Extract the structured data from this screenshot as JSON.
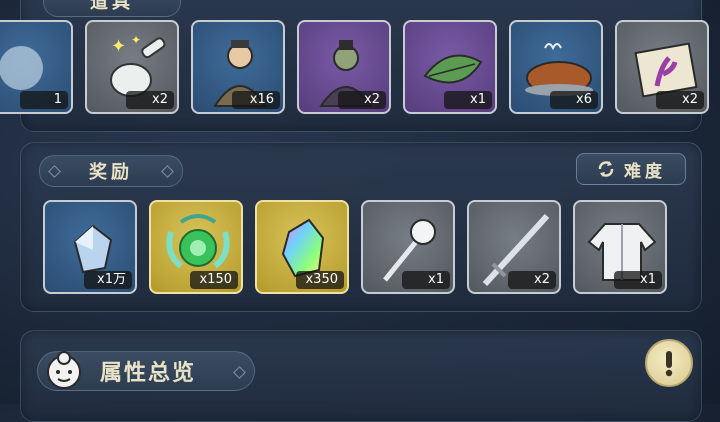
{
  "items_section": {
    "title": "道具",
    "items": [
      {
        "icon": "cut-item-icon",
        "qty": "1",
        "bg": "blue"
      },
      {
        "icon": "sparkling-spoon-icon",
        "qty": "x2",
        "bg": "grey"
      },
      {
        "icon": "villager-figure-icon",
        "qty": "x16",
        "bg": "blue"
      },
      {
        "icon": "dark-figure-icon",
        "qty": "x2",
        "bg": "purple"
      },
      {
        "icon": "green-leaf-icon",
        "qty": "x1",
        "bg": "purple"
      },
      {
        "icon": "roast-pig-icon",
        "qty": "x6",
        "bg": "blue"
      },
      {
        "icon": "scroll-coral-icon",
        "qty": "x2",
        "bg": "grey"
      }
    ]
  },
  "rewards_section": {
    "title": "奖励",
    "difficulty_label": "难度",
    "items": [
      {
        "icon": "blue-crystal-icon",
        "qty": "x1万",
        "bg": "blue"
      },
      {
        "icon": "green-orb-icon",
        "qty": "x150",
        "bg": "gold"
      },
      {
        "icon": "rainbow-crystal-icon",
        "qty": "x350",
        "bg": "gold"
      },
      {
        "icon": "mace-icon",
        "qty": "x1",
        "bg": "grey"
      },
      {
        "icon": "sword-icon",
        "qty": "x2",
        "bg": "grey"
      },
      {
        "icon": "robe-icon",
        "qty": "x1",
        "bg": "grey"
      }
    ]
  },
  "attributes_section": {
    "title": "属性总览"
  }
}
